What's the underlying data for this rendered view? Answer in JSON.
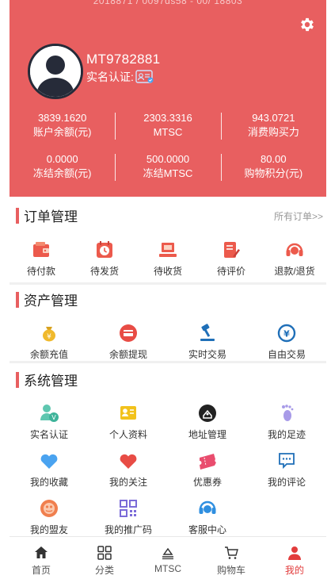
{
  "header": {
    "url_hint": "2018871 / 0097ds58 - 00/ 18803",
    "username": "MT9782881",
    "verify_label": "实名认证:",
    "stats_row1": [
      {
        "value": "3839.1620",
        "label": "账户余额(元)"
      },
      {
        "value": "2303.3316",
        "label": "MTSC"
      },
      {
        "value": "943.0721",
        "label": "消费购买力"
      }
    ],
    "stats_row2": [
      {
        "value": "0.0000",
        "label": "冻结余额(元)"
      },
      {
        "value": "500.0000",
        "label": "冻结MTSC"
      },
      {
        "value": "80.00",
        "label": "购物积分(元)"
      }
    ]
  },
  "orders": {
    "title": "订单管理",
    "more": "所有订单>>",
    "items": [
      {
        "label": "待付款",
        "icon": "wallet-icon"
      },
      {
        "label": "待发货",
        "icon": "clock-icon"
      },
      {
        "label": "待收货",
        "icon": "delivery-icon"
      },
      {
        "label": "待评价",
        "icon": "review-icon"
      },
      {
        "label": "退款/退货",
        "icon": "headset-icon"
      }
    ]
  },
  "assets": {
    "title": "资产管理",
    "items": [
      {
        "label": "余额充值",
        "icon": "money-bag-icon"
      },
      {
        "label": "余额提现",
        "icon": "card-icon"
      },
      {
        "label": "实时交易",
        "icon": "gavel-icon"
      },
      {
        "label": "自由交易",
        "icon": "exchange-icon"
      }
    ]
  },
  "system": {
    "title": "系统管理",
    "rows": [
      [
        {
          "label": "实名认证",
          "icon": "verified-user-icon"
        },
        {
          "label": "个人资料",
          "icon": "profile-card-icon"
        },
        {
          "label": "地址管理",
          "icon": "address-icon"
        },
        {
          "label": "我的足迹",
          "icon": "footprint-icon"
        }
      ],
      [
        {
          "label": "我的收藏",
          "icon": "favorite-icon"
        },
        {
          "label": "我的关注",
          "icon": "heart-icon"
        },
        {
          "label": "优惠券",
          "icon": "coupon-icon"
        },
        {
          "label": "我的评论",
          "icon": "comment-icon"
        }
      ],
      [
        {
          "label": "我的盟友",
          "icon": "ally-icon"
        },
        {
          "label": "我的推广码",
          "icon": "qrcode-icon"
        },
        {
          "label": "客服中心",
          "icon": "service-icon"
        }
      ]
    ]
  },
  "tabbar": [
    {
      "label": "首页",
      "icon": "home-icon"
    },
    {
      "label": "分类",
      "icon": "category-icon"
    },
    {
      "label": "MTSC",
      "icon": "mtsc-icon"
    },
    {
      "label": "购物车",
      "icon": "cart-icon"
    },
    {
      "label": "我的",
      "icon": "me-icon",
      "active": true
    }
  ],
  "colors": {
    "accent": "#e85f60",
    "active_tab": "#e23c3c"
  }
}
